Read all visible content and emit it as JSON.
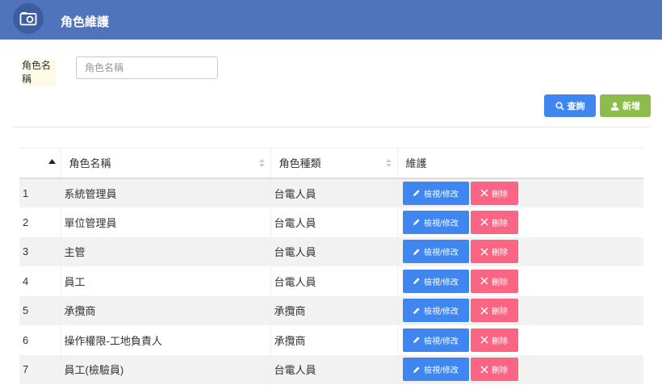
{
  "header": {
    "title": "角色維護",
    "logo_icon": "camera-icon"
  },
  "filter": {
    "label": "角色名稱",
    "placeholder": "角色名稱",
    "value": ""
  },
  "buttons": {
    "search": "查詢",
    "add": "新增"
  },
  "table": {
    "columns": [
      "",
      "角色名稱",
      "角色種類",
      "維護"
    ],
    "actions": {
      "view": "檢視/修改",
      "delete": "刪除"
    },
    "rows": [
      {
        "idx": "1",
        "name": "系統管理員",
        "type": "台電人員"
      },
      {
        "idx": "2",
        "name": "單位管理員",
        "type": "台電人員"
      },
      {
        "idx": "3",
        "name": "主管",
        "type": "台電人員"
      },
      {
        "idx": "4",
        "name": "員工",
        "type": "台電人員"
      },
      {
        "idx": "5",
        "name": "承攬商",
        "type": "承攬商"
      },
      {
        "idx": "6",
        "name": "操作權限-工地負責人",
        "type": "承攬商"
      },
      {
        "idx": "7",
        "name": "員工(檢驗員)",
        "type": "台電人員"
      }
    ]
  },
  "colors": {
    "header": "#4f74bc",
    "primary": "#3f86f0",
    "success": "#8dbb4c",
    "danger": "#fb6584"
  }
}
